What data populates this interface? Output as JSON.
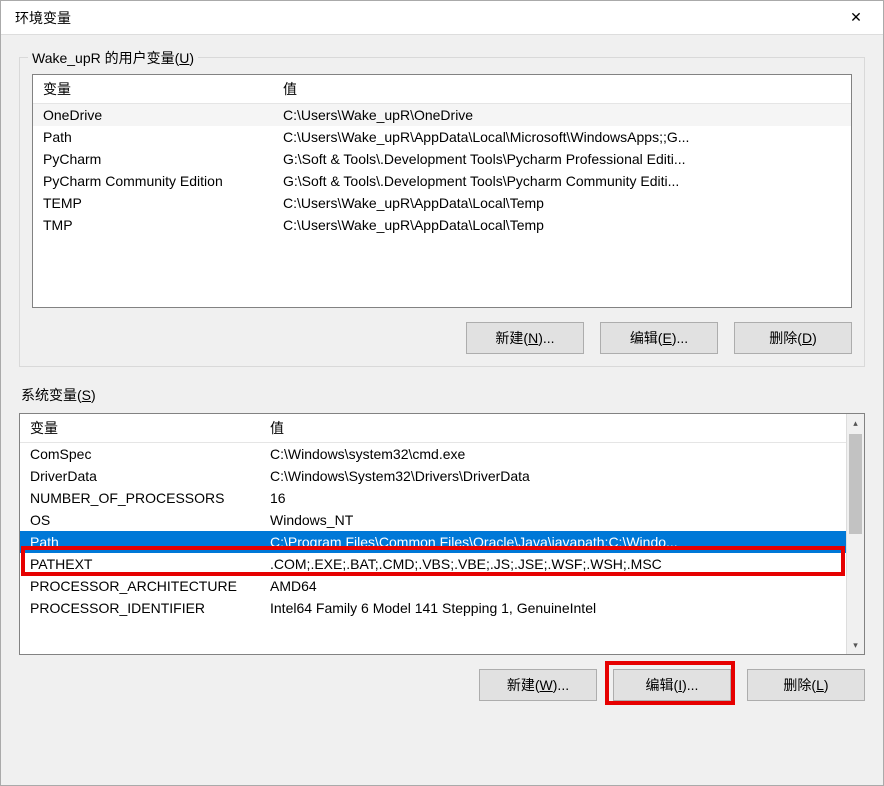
{
  "window": {
    "title": "环境变量",
    "close_icon": "✕"
  },
  "user_group": {
    "label_prefix": "Wake_upR 的用户变量(",
    "label_hotkey": "U",
    "label_suffix": ")",
    "columns": {
      "name": "变量",
      "value": "值"
    },
    "rows": [
      {
        "name": "OneDrive",
        "value": "C:\\Users\\Wake_upR\\OneDrive"
      },
      {
        "name": "Path",
        "value": "C:\\Users\\Wake_upR\\AppData\\Local\\Microsoft\\WindowsApps;;G..."
      },
      {
        "name": "PyCharm",
        "value": "G:\\Soft & Tools\\.Development Tools\\Pycharm Professional Editi..."
      },
      {
        "name": "PyCharm Community Edition",
        "value": "G:\\Soft & Tools\\.Development Tools\\Pycharm Community Editi..."
      },
      {
        "name": "TEMP",
        "value": "C:\\Users\\Wake_upR\\AppData\\Local\\Temp"
      },
      {
        "name": "TMP",
        "value": "C:\\Users\\Wake_upR\\AppData\\Local\\Temp"
      }
    ],
    "buttons": {
      "new_prefix": "新建(",
      "new_hotkey": "N",
      "new_suffix": ")...",
      "edit_prefix": "编辑(",
      "edit_hotkey": "E",
      "edit_suffix": ")...",
      "del_prefix": "删除(",
      "del_hotkey": "D",
      "del_suffix": ")"
    }
  },
  "sys_group": {
    "label_prefix": "系统变量(",
    "label_hotkey": "S",
    "label_suffix": ")",
    "columns": {
      "name": "变量",
      "value": "值"
    },
    "rows": [
      {
        "name": "ComSpec",
        "value": "C:\\Windows\\system32\\cmd.exe"
      },
      {
        "name": "DriverData",
        "value": "C:\\Windows\\System32\\Drivers\\DriverData"
      },
      {
        "name": "NUMBER_OF_PROCESSORS",
        "value": "16"
      },
      {
        "name": "OS",
        "value": "Windows_NT"
      },
      {
        "name": "Path",
        "value": "C:\\Program Files\\Common Files\\Oracle\\Java\\javapath;C:\\Windo...",
        "selected": true
      },
      {
        "name": "PATHEXT",
        "value": ".COM;.EXE;.BAT;.CMD;.VBS;.VBE;.JS;.JSE;.WSF;.WSH;.MSC"
      },
      {
        "name": "PROCESSOR_ARCHITECTURE",
        "value": "AMD64"
      },
      {
        "name": "PROCESSOR_IDENTIFIER",
        "value": "Intel64 Family 6 Model 141 Stepping 1, GenuineIntel"
      }
    ],
    "buttons": {
      "new_prefix": "新建(",
      "new_hotkey": "W",
      "new_suffix": ")...",
      "edit_prefix": "编辑(",
      "edit_hotkey": "I",
      "edit_suffix": ")...",
      "del_prefix": "删除(",
      "del_hotkey": "L",
      "del_suffix": ")"
    }
  }
}
